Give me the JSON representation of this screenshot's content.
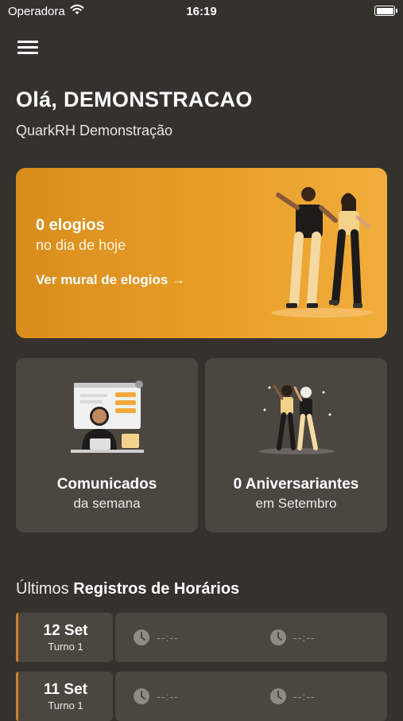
{
  "status_bar": {
    "carrier": "Operadora",
    "time": "16:19"
  },
  "header": {
    "greeting": "Olá, DEMONSTRACAO",
    "company": "QuarkRH Demonstração"
  },
  "hero": {
    "count": "0 elogios",
    "subtitle": "no dia de hoje",
    "link": "Ver mural de elogios →"
  },
  "cards": [
    {
      "title": "Comunicados",
      "subtitle": "da semana"
    },
    {
      "title": "0 Aniversariantes",
      "subtitle": "em Setembro"
    }
  ],
  "records_section": {
    "prefix": "Últimos ",
    "title": "Registros de Horários"
  },
  "records": [
    {
      "day": "12 Set",
      "shift": "Turno 1",
      "entry": "--:--",
      "exit": "--:--"
    },
    {
      "day": "11 Set",
      "shift": "Turno 1",
      "entry": "--:--",
      "exit": "--:--"
    }
  ],
  "colors": {
    "background": "#35322d",
    "card": "#4b4640",
    "accent": "#e89d26",
    "record_marker": "#d27f2b"
  }
}
